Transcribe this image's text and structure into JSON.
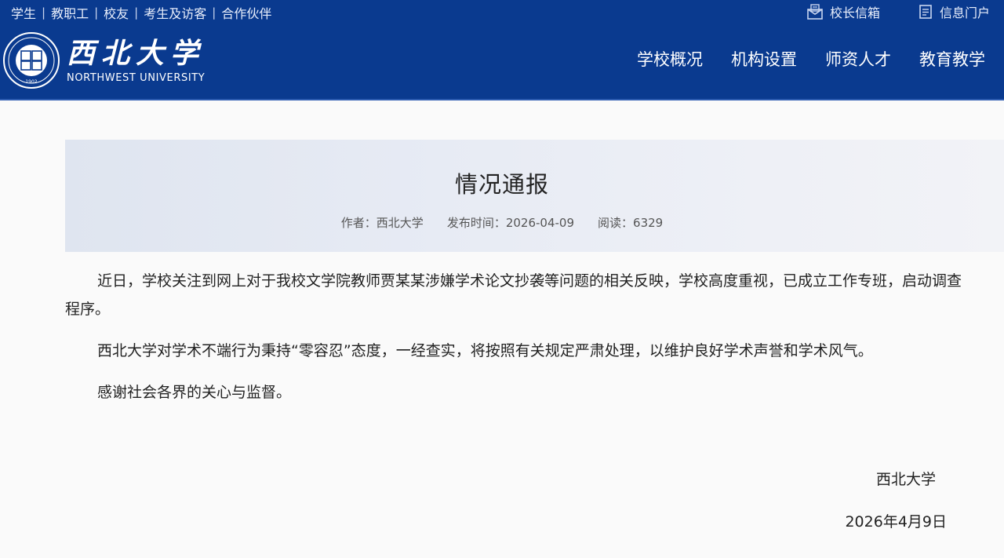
{
  "header": {
    "top_links": [
      "学生",
      "教职工",
      "校友",
      "考生及访客",
      "合作伙伴"
    ],
    "separator": "|",
    "right_links": [
      {
        "label": "校长信箱",
        "icon": "mail-icon"
      },
      {
        "label": "信息门户",
        "icon": "portal-icon"
      }
    ],
    "logo": {
      "name_cn": "西北大学",
      "name_en": "NORTHWEST UNIVERSITY",
      "seal_year": "1902"
    },
    "nav": [
      "学校概况",
      "机构设置",
      "师资人才",
      "教育教学"
    ],
    "colors": {
      "background": "#0a3a8f",
      "text": "#ffffff"
    }
  },
  "article": {
    "title": "情况通报",
    "author_label": "作者：",
    "author": "西北大学",
    "date_label": "发布时间：",
    "date": "2026-04-09",
    "views_label": "阅读：",
    "views": "6329",
    "paragraphs": [
      "近日，学校关注到网上对于我校文学院教师贾某某涉嫌学术论文抄袭等问题的相关反映，学校高度重视，已成立工作专班，启动调查程序。",
      "西北大学对学术不端行为秉持“零容忍”态度，一经查实，将按照有关规定严肃处理，以维护良好学术声誉和学术风气。",
      "感谢社会各界的关心与监督。"
    ],
    "signature": "西北大学",
    "signature_date": "2026年4月9日"
  }
}
